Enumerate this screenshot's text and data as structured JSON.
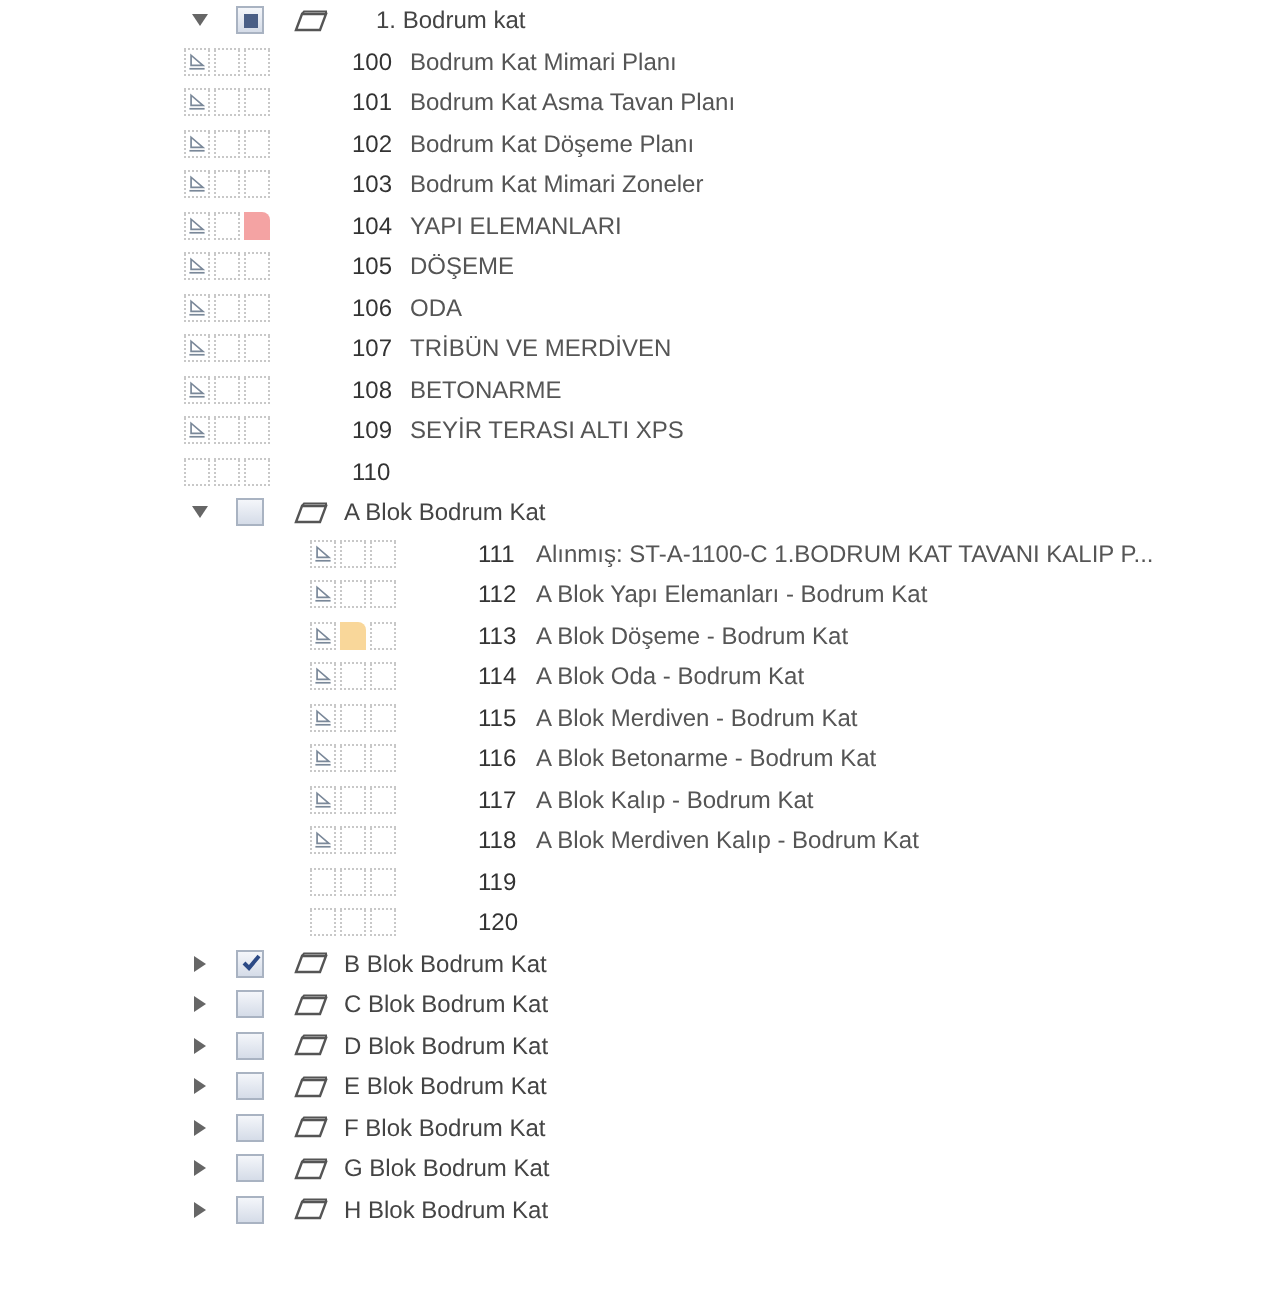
{
  "groups": [
    {
      "label": "1. Bodrum kat",
      "expanded": true,
      "checked": false,
      "partial": true,
      "sheets": [
        {
          "number": "100",
          "name": "Bodrum Kat Mimari Planı",
          "drawing": true
        },
        {
          "number": "101",
          "name": "Bodrum Kat Asma Tavan Planı",
          "drawing": true
        },
        {
          "number": "102",
          "name": "Bodrum Kat Döşeme Planı",
          "drawing": true
        },
        {
          "number": "103",
          "name": "Bodrum Kat Mimari Zoneler",
          "drawing": true
        },
        {
          "number": "104",
          "name": "YAPI ELEMANLARI",
          "drawing": true,
          "third_slot_note": {
            "color": "#f4a3a3"
          }
        },
        {
          "number": "105",
          "name": "DÖŞEME",
          "drawing": true
        },
        {
          "number": "106",
          "name": "ODA",
          "drawing": true
        },
        {
          "number": "107",
          "name": "TRİBÜN VE MERDİVEN",
          "drawing": true
        },
        {
          "number": "108",
          "name": "BETONARME",
          "drawing": true
        },
        {
          "number": "109",
          "name": "SEYİR TERASI ALTI XPS",
          "drawing": true
        },
        {
          "number": "110",
          "drawing": false
        }
      ]
    },
    {
      "label": "A Blok Bodrum Kat",
      "expanded": true,
      "checked": false,
      "sheets": [
        {
          "number": "111",
          "name": "Alınmış: ST-A-1100-C 1.BODRUM KAT TAVANI KALIP P...",
          "drawing": true
        },
        {
          "number": "112",
          "name": "A Blok Yapı Elemanları - Bodrum Kat",
          "drawing": true
        },
        {
          "number": "113",
          "name": "A Blok Döşeme - Bodrum Kat",
          "drawing": true,
          "second_slot_note": {
            "color": "#f9d79a"
          }
        },
        {
          "number": "114",
          "name": "A Blok Oda - Bodrum Kat",
          "drawing": true
        },
        {
          "number": "115",
          "name": "A Blok Merdiven - Bodrum Kat",
          "drawing": true
        },
        {
          "number": "116",
          "name": "A Blok Betonarme - Bodrum Kat",
          "drawing": true
        },
        {
          "number": "117",
          "name": "A Blok Kalıp - Bodrum Kat",
          "drawing": true
        },
        {
          "number": "118",
          "name": "A Blok Merdiven Kalıp - Bodrum Kat",
          "drawing": true
        },
        {
          "number": "119",
          "drawing": false
        },
        {
          "number": "120",
          "drawing": false
        }
      ]
    },
    {
      "label": "B Blok Bodrum Kat",
      "expanded": false,
      "checked": true
    },
    {
      "label": "C Blok Bodrum Kat",
      "expanded": false,
      "checked": false
    },
    {
      "label": "D Blok Bodrum Kat",
      "expanded": false,
      "checked": false
    },
    {
      "label": "E Blok Bodrum Kat",
      "expanded": false,
      "checked": false
    },
    {
      "label": "F Blok Bodrum Kat",
      "expanded": false,
      "checked": false
    },
    {
      "label": "G Blok Bodrum Kat",
      "expanded": false,
      "checked": false
    },
    {
      "label": "H Blok Bodrum Kat",
      "expanded": false,
      "checked": false
    }
  ]
}
